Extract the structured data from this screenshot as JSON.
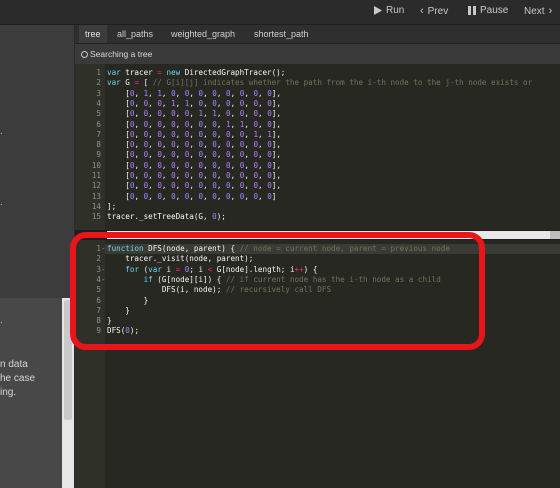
{
  "toolbar": {
    "run_label": "Run",
    "prev_label": "Prev",
    "pause_label": "Pause",
    "next_label": "Next"
  },
  "tabs": [
    "tree",
    "all_paths",
    "weighted_graph",
    "shortest_path"
  ],
  "active_tab": "tree",
  "status": {
    "text": "Searching a tree"
  },
  "left_panel": {
    "lines": [
      "n data",
      "he case",
      "ing."
    ]
  },
  "colors": {
    "annotation": "#e8161b",
    "keyword": "#66d9ef",
    "comment": "#75715e",
    "number": "#ae81ff",
    "operator": "#f92672"
  },
  "editor1": {
    "lines": [
      {
        "n": "1",
        "t": "var tracer = new DirectedGraphTracer();"
      },
      {
        "n": "2",
        "t": "var G = [ // G[i][j] indicates whether the path from the i-th node to the j-th node exists or"
      },
      {
        "n": "3",
        "t": "    [0, 1, 1, 0, 0, 0, 0, 0, 0, 0, 0],"
      },
      {
        "n": "4",
        "t": "    [0, 0, 0, 1, 1, 0, 0, 0, 0, 0, 0],"
      },
      {
        "n": "5",
        "t": "    [0, 0, 0, 0, 0, 1, 1, 0, 0, 0, 0],"
      },
      {
        "n": "6",
        "t": "    [0, 0, 0, 0, 0, 0, 0, 1, 1, 0, 0],"
      },
      {
        "n": "7",
        "t": "    [0, 0, 0, 0, 0, 0, 0, 0, 0, 1, 1],"
      },
      {
        "n": "8",
        "t": "    [0, 0, 0, 0, 0, 0, 0, 0, 0, 0, 0],"
      },
      {
        "n": "9",
        "t": "    [0, 0, 0, 0, 0, 0, 0, 0, 0, 0, 0],"
      },
      {
        "n": "10",
        "t": "    [0, 0, 0, 0, 0, 0, 0, 0, 0, 0, 0],"
      },
      {
        "n": "11",
        "t": "    [0, 0, 0, 0, 0, 0, 0, 0, 0, 0, 0],"
      },
      {
        "n": "12",
        "t": "    [0, 0, 0, 0, 0, 0, 0, 0, 0, 0, 0],"
      },
      {
        "n": "13",
        "t": "    [0, 0, 0, 0, 0, 0, 0, 0, 0, 0, 0]"
      },
      {
        "n": "14",
        "t": "];"
      },
      {
        "n": "15",
        "t": "tracer._setTreeData(G, 0);"
      }
    ]
  },
  "editor2": {
    "lines": [
      {
        "n": "1",
        "f": "-",
        "t": "function DFS(node, parent) { // node = current node, parent = previous node"
      },
      {
        "n": "2",
        "f": "",
        "t": "    tracer._visit(node, parent);"
      },
      {
        "n": "3",
        "f": "-",
        "t": "    for (var i = 0; i < G[node].length; i++) {"
      },
      {
        "n": "4",
        "f": "-",
        "t": "        if (G[node][i]) { // if current node has the i-th node as a child"
      },
      {
        "n": "5",
        "f": "",
        "t": "            DFS(i, node); // recursively call DFS"
      },
      {
        "n": "6",
        "f": "",
        "t": "        }"
      },
      {
        "n": "7",
        "f": "",
        "t": "    }"
      },
      {
        "n": "8",
        "f": "",
        "t": "}"
      },
      {
        "n": "9",
        "f": "",
        "t": "DFS(0);"
      }
    ]
  }
}
